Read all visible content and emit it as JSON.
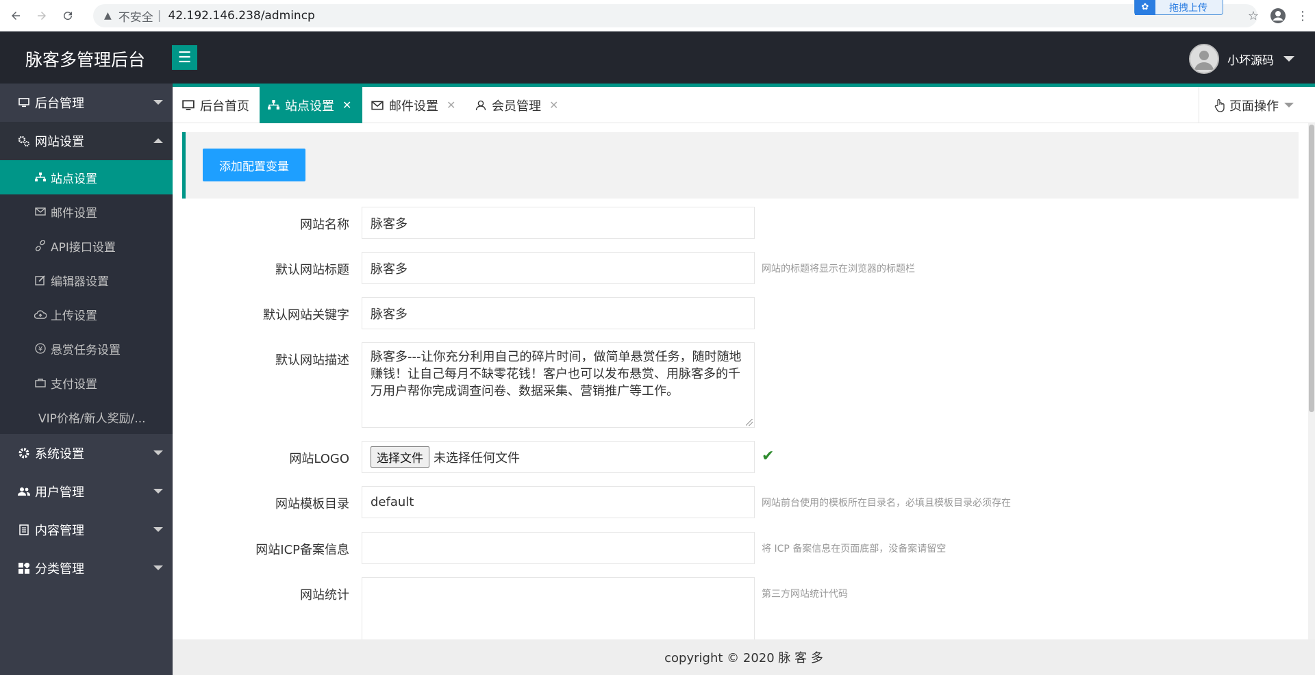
{
  "browser": {
    "insecure_label": "不安全",
    "url": "42.192.146.238/admincp",
    "upload_label": "拖拽上传"
  },
  "header": {
    "brand": "脉客多管理后台",
    "user_name": "小坏源码"
  },
  "sidebar": {
    "groups": [
      {
        "label": "后台管理",
        "icon": "monitor-icon"
      },
      {
        "label": "网站设置",
        "icon": "gears-icon"
      },
      {
        "label": "系统设置",
        "icon": "gear-icon"
      },
      {
        "label": "用户管理",
        "icon": "users-icon"
      },
      {
        "label": "内容管理",
        "icon": "document-icon"
      },
      {
        "label": "分类管理",
        "icon": "grid-icon"
      }
    ],
    "sub_items": [
      {
        "label": "站点设置",
        "icon": "sitemap-icon"
      },
      {
        "label": "邮件设置",
        "icon": "mail-icon"
      },
      {
        "label": "API接口设置",
        "icon": "link-icon"
      },
      {
        "label": "编辑器设置",
        "icon": "edit-icon"
      },
      {
        "label": "上传设置",
        "icon": "cloud-upload-icon"
      },
      {
        "label": "悬赏任务设置",
        "icon": "yen-icon"
      },
      {
        "label": "支付设置",
        "icon": "bag-icon"
      },
      {
        "label": "VIP价格/新人奖励/..."
      }
    ]
  },
  "tabs": [
    {
      "label": "后台首页",
      "icon": "monitor-icon"
    },
    {
      "label": "站点设置",
      "icon": "sitemap-icon"
    },
    {
      "label": "邮件设置",
      "icon": "mail-icon"
    },
    {
      "label": "会员管理",
      "icon": "user-icon"
    }
  ],
  "page_ops_label": "页面操作",
  "content": {
    "add_button": "添加配置变量",
    "fields": [
      {
        "label": "网站名称",
        "value": "脉客多",
        "hint": ""
      },
      {
        "label": "默认网站标题",
        "value": "脉客多",
        "hint": "网站的标题将显示在浏览器的标题栏"
      },
      {
        "label": "默认网站关键字",
        "value": "脉客多",
        "hint": ""
      },
      {
        "label": "默认网站描述",
        "value": "脉客多---让你充分利用自己的碎片时间，做简单悬赏任务，随时随地赚钱！让自己每月不缺零花钱！客户也可以发布悬赏、用脉客多的千万用户帮你完成调查问卷、数据采集、营销推广等工作。",
        "hint": ""
      },
      {
        "label": "网站LOGO",
        "file_button": "选择文件",
        "file_status": "未选择任何文件",
        "hint": ""
      },
      {
        "label": "网站模板目录",
        "value": "default",
        "hint": "网站前台使用的模板所在目录名，必填且模板目录必须存在"
      },
      {
        "label": "网站ICP备案信息",
        "value": "",
        "hint": "将 ICP 备案信息在页面底部，没备案请留空"
      },
      {
        "label": "网站统计",
        "value": "",
        "hint": "第三方网站统计代码"
      }
    ]
  },
  "footer": "copyright © 2020 脉 客 多",
  "colors": {
    "accent": "#009688",
    "header_bg": "#23262e",
    "sidebar_bg": "#393d49",
    "button_blue": "#1e9fff"
  }
}
